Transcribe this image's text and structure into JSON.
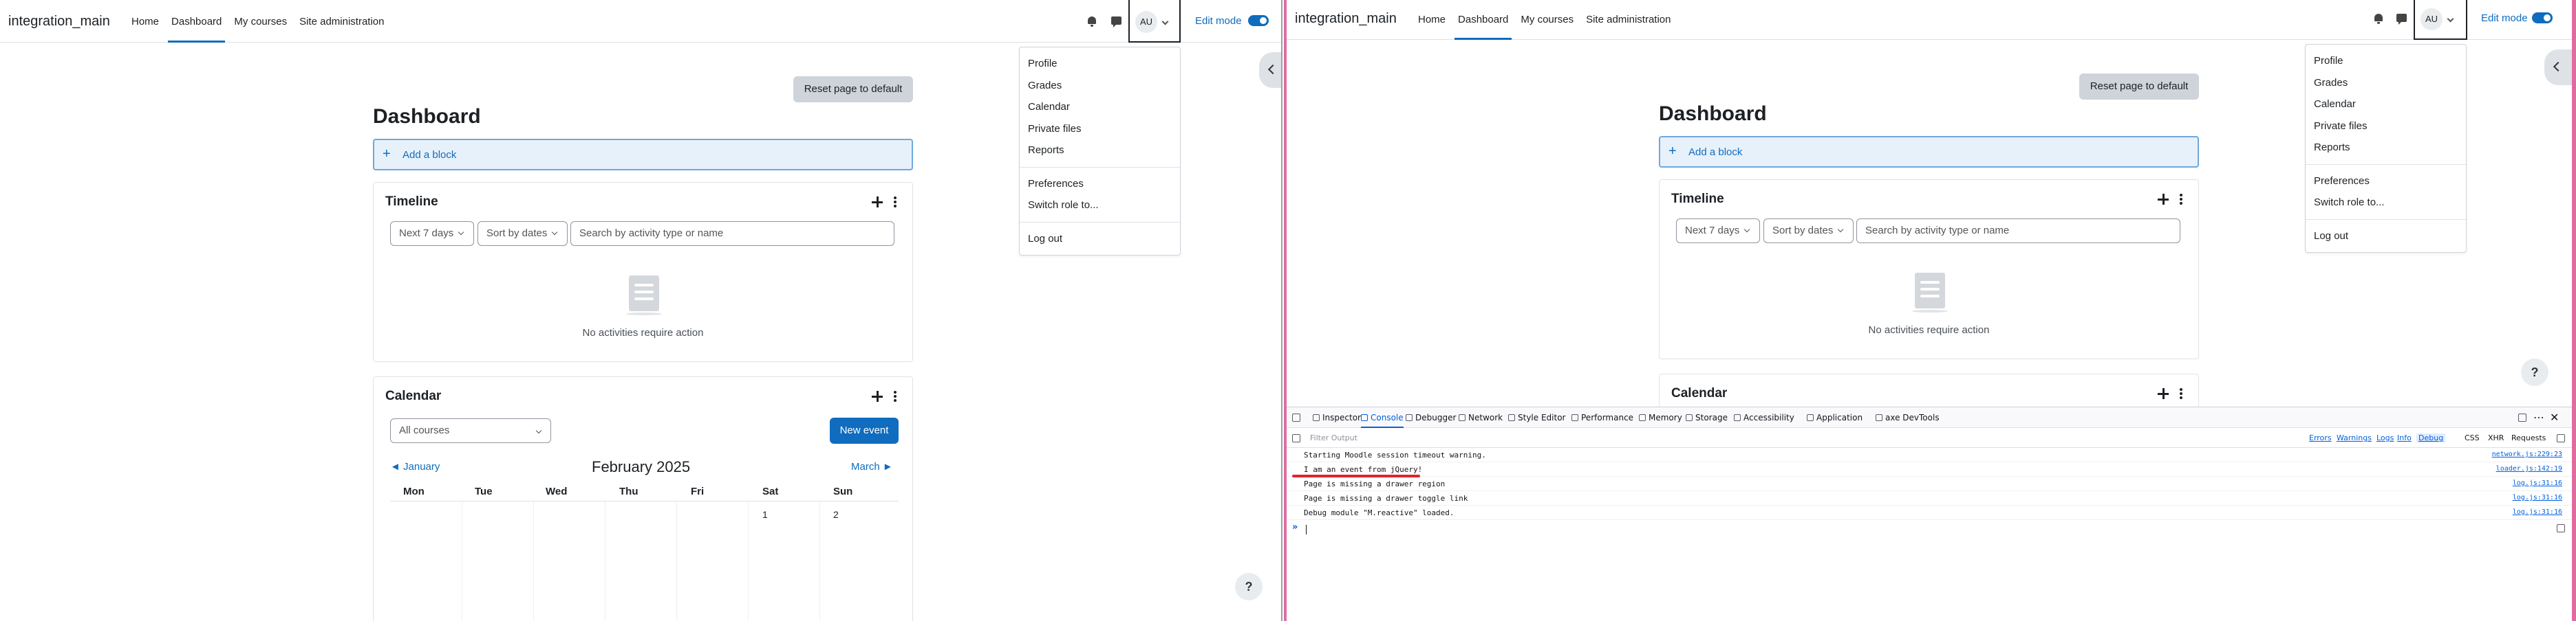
{
  "site": {
    "brand": "integration_main",
    "nav": [
      "Home",
      "Dashboard",
      "My courses",
      "Site administration"
    ],
    "active_nav": "Dashboard",
    "user_initials": "AU",
    "edit_mode_label": "Edit mode"
  },
  "user_menu": {
    "group1": [
      "Profile",
      "Grades",
      "Calendar",
      "Private files",
      "Reports"
    ],
    "group2": [
      "Preferences",
      "Switch role to..."
    ],
    "group3": [
      "Log out"
    ]
  },
  "dashboard": {
    "reset_label": "Reset page to default",
    "title": "Dashboard",
    "add_block_label": "Add a block"
  },
  "timeline": {
    "title": "Timeline",
    "range_select": "Next 7 days",
    "sort_select": "Sort by dates",
    "search_placeholder": "Search by activity type or name",
    "empty_text": "No activities require action"
  },
  "calendar": {
    "title": "Calendar",
    "course_select": "All courses",
    "new_event_label": "New event",
    "prev_month": "◄ January",
    "next_month": "March ►",
    "month": "February 2025",
    "weekdays": [
      "Mon",
      "Tue",
      "Wed",
      "Thu",
      "Fri",
      "Sat",
      "Sun"
    ],
    "first_days": [
      "1",
      "2"
    ]
  },
  "help_label": "?",
  "devtools": {
    "tabs": [
      "Inspector",
      "Console",
      "Debugger",
      "Network",
      "Style Editor",
      "Performance",
      "Memory",
      "Storage",
      "Accessibility",
      "Application",
      "axe DevTools"
    ],
    "active_tab": "Console",
    "filter_placeholder": "Filter Output",
    "levels": [
      "Errors",
      "Warnings",
      "Logs",
      "Info",
      "Debug"
    ],
    "extra": [
      "CSS",
      "XHR",
      "Requests"
    ],
    "messages": [
      {
        "text": "Starting Moodle session timeout warning.",
        "source": "network.js:229:23"
      },
      {
        "text": "I am an event from jQuery!",
        "source": "loader.js:142:19"
      },
      {
        "text": "Page is missing a drawer region",
        "source": "log.js:31:16"
      },
      {
        "text": "Page is missing a drawer toggle link",
        "source": "log.js:31:16"
      },
      {
        "text": "Debug module \"M.reactive\" loaded.",
        "source": "log.js:31:16"
      }
    ],
    "prompt": "»"
  },
  "colors": {
    "accent": "#0f6cbf",
    "frame_border": "#e06c9f",
    "underline_mark": "#e0242a"
  }
}
